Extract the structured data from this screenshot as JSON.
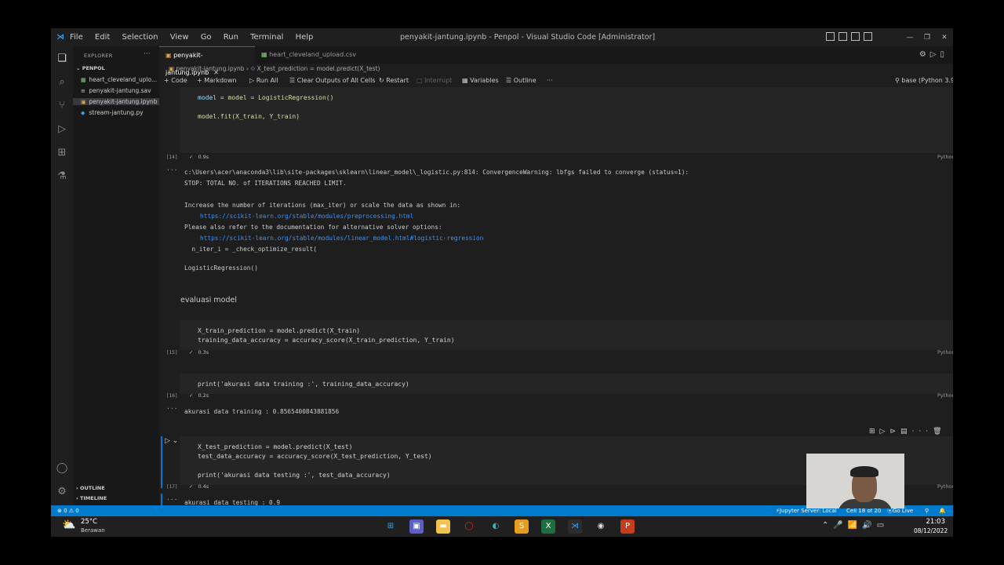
{
  "window": {
    "title": "penyakit-jantung.ipynb - Penpol - Visual Studio Code [Administrator]",
    "menu": [
      "File",
      "Edit",
      "Selection",
      "View",
      "Go",
      "Run",
      "Terminal",
      "Help"
    ]
  },
  "sidebar": {
    "header": "EXPLORER",
    "folder": "PENPOL",
    "files": [
      {
        "name": "heart_cleveland_uplo...",
        "icon": "table-icon"
      },
      {
        "name": "penyakit-jantung.sav",
        "icon": "file-icon"
      },
      {
        "name": "penyakit-jantung.ipynb",
        "icon": "notebook-icon"
      },
      {
        "name": "stream-jantung.py",
        "icon": "python-icon"
      }
    ],
    "outline": "OUTLINE",
    "timeline": "TIMELINE"
  },
  "tabs": [
    {
      "label": "penyakit-jantung.ipynb",
      "active": true
    },
    {
      "label": "heart_cleveland_upload.csv",
      "active": false
    }
  ],
  "breadcrumb": {
    "file": "penyakit-jantung.ipynb",
    "symbol": "X_test_prediction = model.predict(X_test)"
  },
  "toolbar": {
    "code": "Code",
    "markdown": "Markdown",
    "run_all": "Run All",
    "clear": "Clear Outputs of All Cells",
    "restart": "Restart",
    "interrupt": "Interrupt",
    "variables": "Variables",
    "outline": "Outline",
    "kernel": "base (Python 3.9."
  },
  "cells": {
    "c14": {
      "line1": "model = LogisticRegression()",
      "line2": "model.fit(X_train, Y_train)",
      "exec": "[14]",
      "time": "0.9s",
      "lang": "Python",
      "out": [
        "c:\\Users\\acer\\anaconda3\\lib\\site-packages\\sklearn\\linear_model\\_logistic.py:814: ConvergenceWarning: lbfgs failed to converge (status=1):",
        "STOP: TOTAL NO. of ITERATIONS REACHED LIMIT.",
        "Increase the number of iterations (max_iter) or scale the data as shown in:",
        "https://scikit-learn.org/stable/modules/preprocessing.html",
        "Please also refer to the documentation for alternative solver options:",
        "https://scikit-learn.org/stable/modules/linear_model.html#logistic-regression",
        "  n_iter_i = _check_optimize_result(",
        "LogisticRegression()"
      ]
    },
    "md": "evaluasi model",
    "c15": {
      "line1": "X_train_prediction = model.predict(X_train)",
      "line2": "training_data_accuracy = accuracy_score(X_train_prediction, Y_train)",
      "exec": "[15]",
      "time": "0.3s",
      "lang": "Python"
    },
    "c16": {
      "line1": "print('akurasi data training :', training_data_accuracy)",
      "exec": "[16]",
      "time": "0.2s",
      "lang": "Python",
      "out": "akurasi data training : 0.8565400843881856"
    },
    "c17": {
      "line1": "X_test_prediction = model.predict(X_test)",
      "line2": "test_data_accuracy = accuracy_score(X_test_prediction, Y_test)",
      "line3": "print('akurasi data testing :', test_data_accuracy)",
      "exec": "[17]",
      "time": "0.4s",
      "lang": "Python",
      "out": "akurasi data testing : 0.9"
    }
  },
  "statusbar": {
    "errors": "⊗ 0 ⚠ 0",
    "jupyter": "Jupyter Server: Local",
    "cell": "Cell 18 of 20",
    "golive": "Go Live"
  },
  "taskbar": {
    "temp": "25°C",
    "condition": "Berawan",
    "time": "21:03",
    "date": "08/12/2022"
  },
  "colors": {
    "accent": "#007acc",
    "editor_bg": "#1e1e1e",
    "link": "#3794ff",
    "function": "#dcdcaa",
    "string": "#ce9178"
  }
}
